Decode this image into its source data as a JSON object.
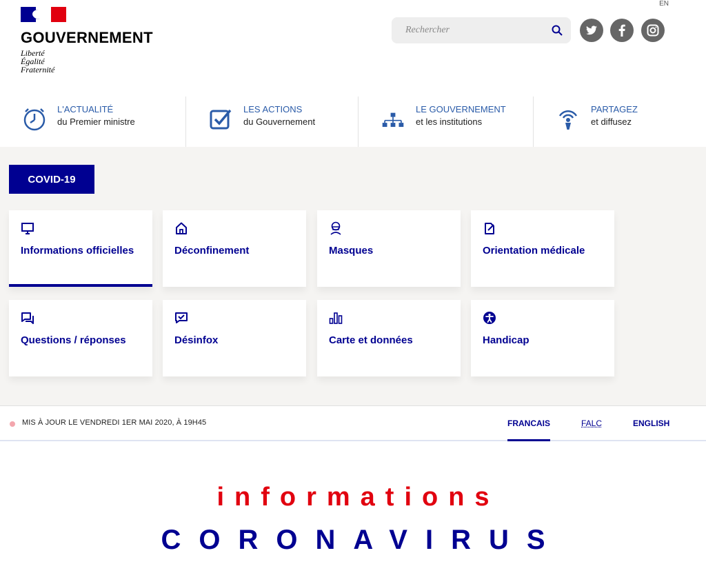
{
  "header": {
    "brand": "GOUVERNEMENT",
    "motto": [
      "Liberté",
      "Égalité",
      "Fraternité"
    ],
    "lang_link": "EN",
    "search": {
      "placeholder": "Rechercher"
    },
    "social": [
      "twitter-icon",
      "facebook-icon",
      "instagram-icon"
    ]
  },
  "mainnav": [
    {
      "title": "L'ACTUALITÉ",
      "subtitle": "du Premier ministre",
      "icon": "clock-icon"
    },
    {
      "title": "LES ACTIONS",
      "subtitle": "du Gouvernement",
      "icon": "checkbox-icon"
    },
    {
      "title": "LE GOUVERNEMENT",
      "subtitle": "et les institutions",
      "icon": "org-chart-icon"
    },
    {
      "title": "PARTAGEZ",
      "subtitle": "et diffusez",
      "icon": "broadcast-icon"
    }
  ],
  "covid": {
    "button": "COVID-19",
    "tiles": [
      {
        "label": "Informations officielles",
        "icon": "monitor-icon"
      },
      {
        "label": "Déconfinement",
        "icon": "home-icon"
      },
      {
        "label": "Masques",
        "icon": "mask-icon"
      },
      {
        "label": "Orientation médicale",
        "icon": "edit-icon"
      },
      {
        "label": "Questions / réponses",
        "icon": "chat-icon"
      },
      {
        "label": "Désinfox",
        "icon": "check-message-icon"
      },
      {
        "label": "Carte et données",
        "icon": "bar-chart-icon"
      },
      {
        "label": "Handicap",
        "icon": "accessibility-icon"
      }
    ]
  },
  "update": {
    "text": "MIS À JOUR LE VENDREDI 1ER MAI 2020, À 19H45",
    "langs": [
      "FRANCAIS",
      "FALC",
      "ENGLISH"
    ]
  },
  "hero": {
    "line1": "informations",
    "line2": "CORONAVIRUS"
  },
  "colors": {
    "blue": "#000091",
    "red": "#e1000f",
    "link": "#2a5ba8"
  }
}
